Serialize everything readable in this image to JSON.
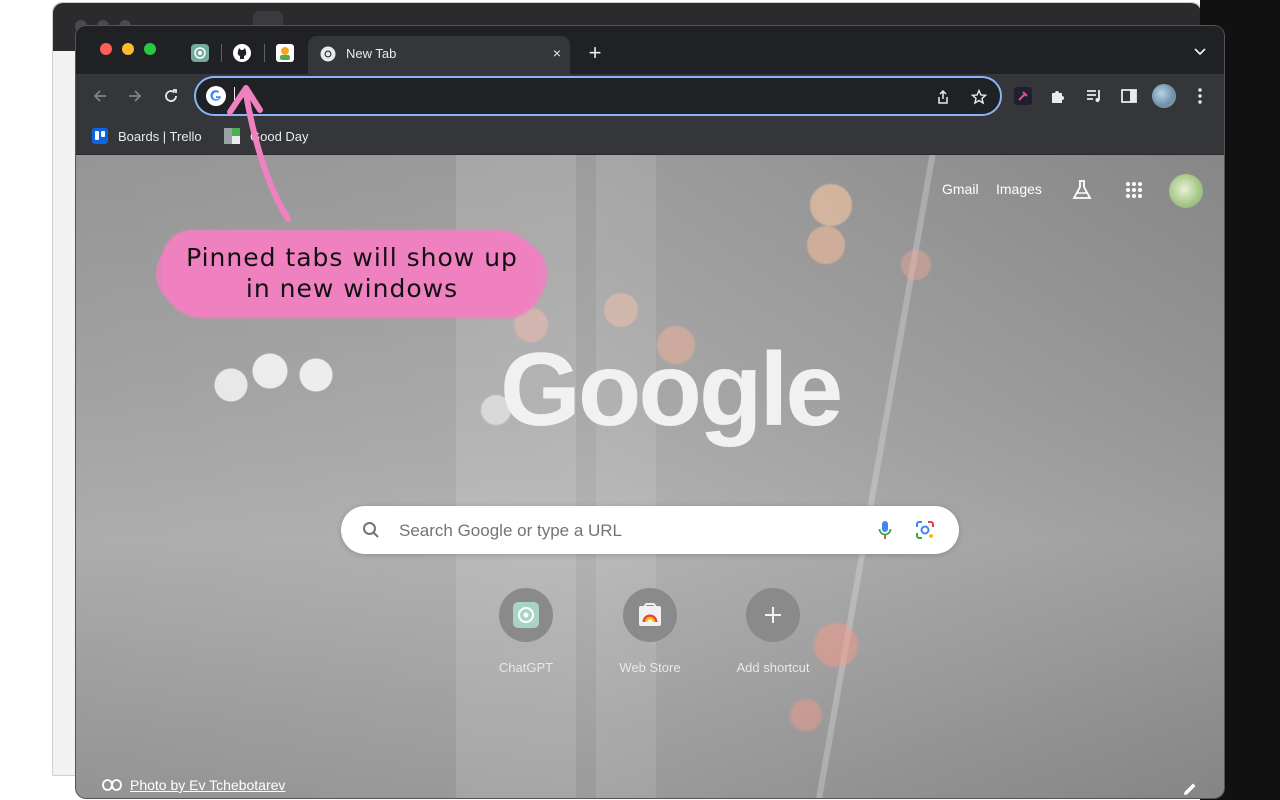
{
  "tabs": {
    "active_title": "New Tab",
    "close_glyph": "×",
    "new_tab_glyph": "+",
    "pinned": [
      "chatgpt-icon",
      "github-icon",
      "goodday-icon"
    ]
  },
  "omnibox": {
    "value": "",
    "placeholder": ""
  },
  "bookmarks": [
    {
      "label": "Boards | Trello",
      "icon": "trello-icon"
    },
    {
      "label": "Good Day",
      "icon": "goodday-icon"
    }
  ],
  "ntp": {
    "gmail": "Gmail",
    "images": "Images",
    "logo": "Google",
    "search_placeholder": "Search Google or type a URL",
    "shortcuts": [
      {
        "label": "ChatGPT",
        "icon": "chatgpt-icon"
      },
      {
        "label": "Web Store",
        "icon": "webstore-icon"
      },
      {
        "label": "Add shortcut",
        "icon": "plus-icon"
      }
    ],
    "photo_credit": "Photo by Ev Tchebotarev"
  },
  "annotation": {
    "line1": "Pinned tabs will show up",
    "line2": "in new windows",
    "color": "#f081c0"
  },
  "colors": {
    "accent": "#8ab4f8",
    "tabstrip": "#202124",
    "toolbar": "#35363a"
  }
}
